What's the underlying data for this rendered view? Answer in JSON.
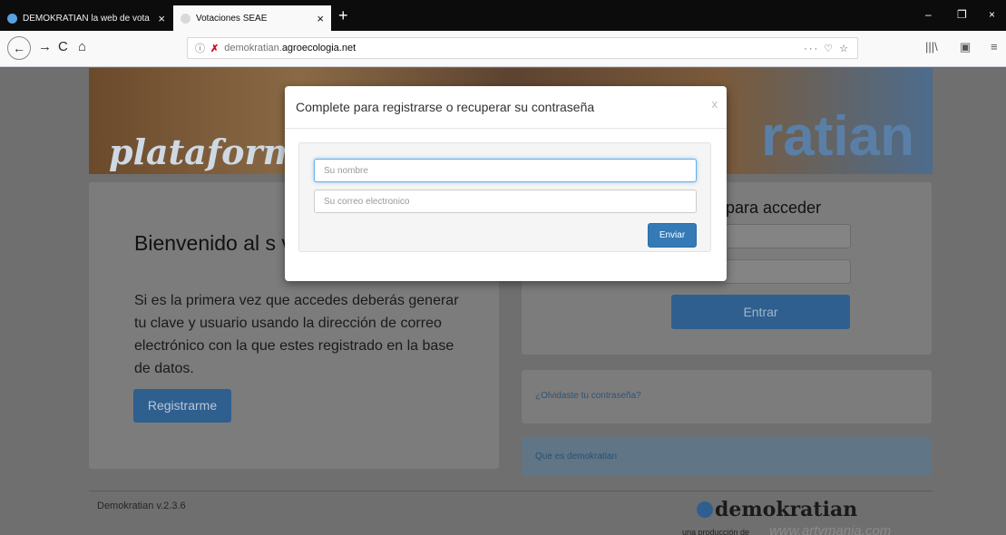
{
  "browser": {
    "tabs": [
      {
        "label": "DEMOKRATIAN la web de vota",
        "close": "×"
      },
      {
        "label": "Votaciones SEAE",
        "close": "×"
      }
    ],
    "new_tab": "+",
    "window_controls": {
      "minimize": "–",
      "restore": "❐",
      "close": "×"
    },
    "nav": {
      "back": "←",
      "forward": "→",
      "reload": "C",
      "home": "⌂"
    },
    "url": {
      "info": "ⓘ",
      "lock": "✗",
      "prefix": "demokratian.",
      "domain": "agroecologia.net",
      "actions": "··· ♡ ☆"
    },
    "toolbar_right": {
      "library": "|||\\",
      "sidebar": "▣",
      "menu": "≡"
    }
  },
  "banner": {
    "left_text": "plataforma d",
    "right_text": "ratian"
  },
  "welcome": {
    "heading": "Bienvenido al s votaciones Vota",
    "text": "Si es la primera vez que accedes deberás generar tu clave y usuario usando la dirección de correo electrónico con la que estes registrado en la base de datos.",
    "register_label": "Registrarme"
  },
  "login": {
    "title": "para acceder",
    "submit_label": "Entrar"
  },
  "links": {
    "forgot": "¿Olvidaste tu contraseña?",
    "about": "Que es demokratian"
  },
  "footer": {
    "version": "Demokratian v.2.3.6",
    "logo": "demokratian",
    "credit": "una producción de",
    "credit_site": "www.artymania.com"
  },
  "modal": {
    "title": "Complete para registrarse o recuperar su contraseña",
    "close": "x",
    "name_placeholder": "Su nombre",
    "email_placeholder": "Su correo electronico",
    "submit_label": "Enviar"
  }
}
